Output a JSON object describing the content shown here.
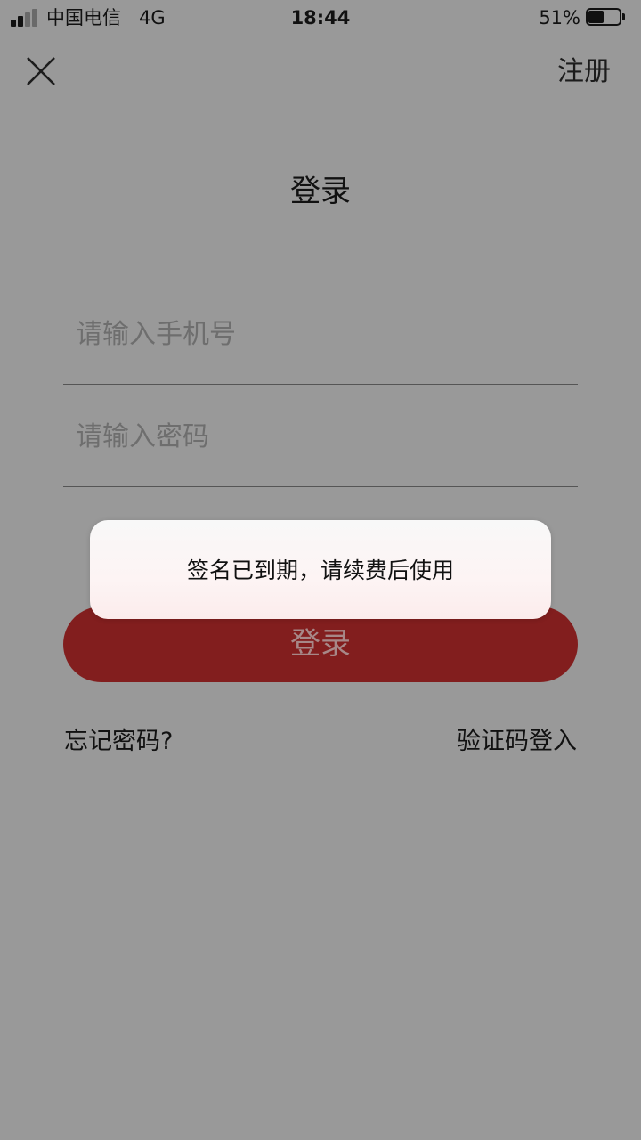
{
  "status_bar": {
    "carrier": "中国电信",
    "network": "4G",
    "time": "18:44",
    "battery_percent_text": "51%",
    "battery_level": 0.51,
    "signal_bars_filled": 2,
    "signal_bars_total": 4
  },
  "nav": {
    "close_icon": "close-x-icon",
    "register_label": "注册"
  },
  "page": {
    "title": "登录"
  },
  "form": {
    "phone_placeholder": "请输入手机号",
    "phone_value": "",
    "password_placeholder": "请输入密码",
    "password_value": "",
    "login_button_label": "登录"
  },
  "links": {
    "forgot_password": "忘记密码?",
    "sms_login": "验证码登入"
  },
  "toast": {
    "message": "签名已到期，请续费后使用"
  },
  "colors": {
    "background": "#999999",
    "login_button": "#821e1e",
    "login_button_text": "#a78888",
    "toast_background": "#f8f8f8"
  }
}
